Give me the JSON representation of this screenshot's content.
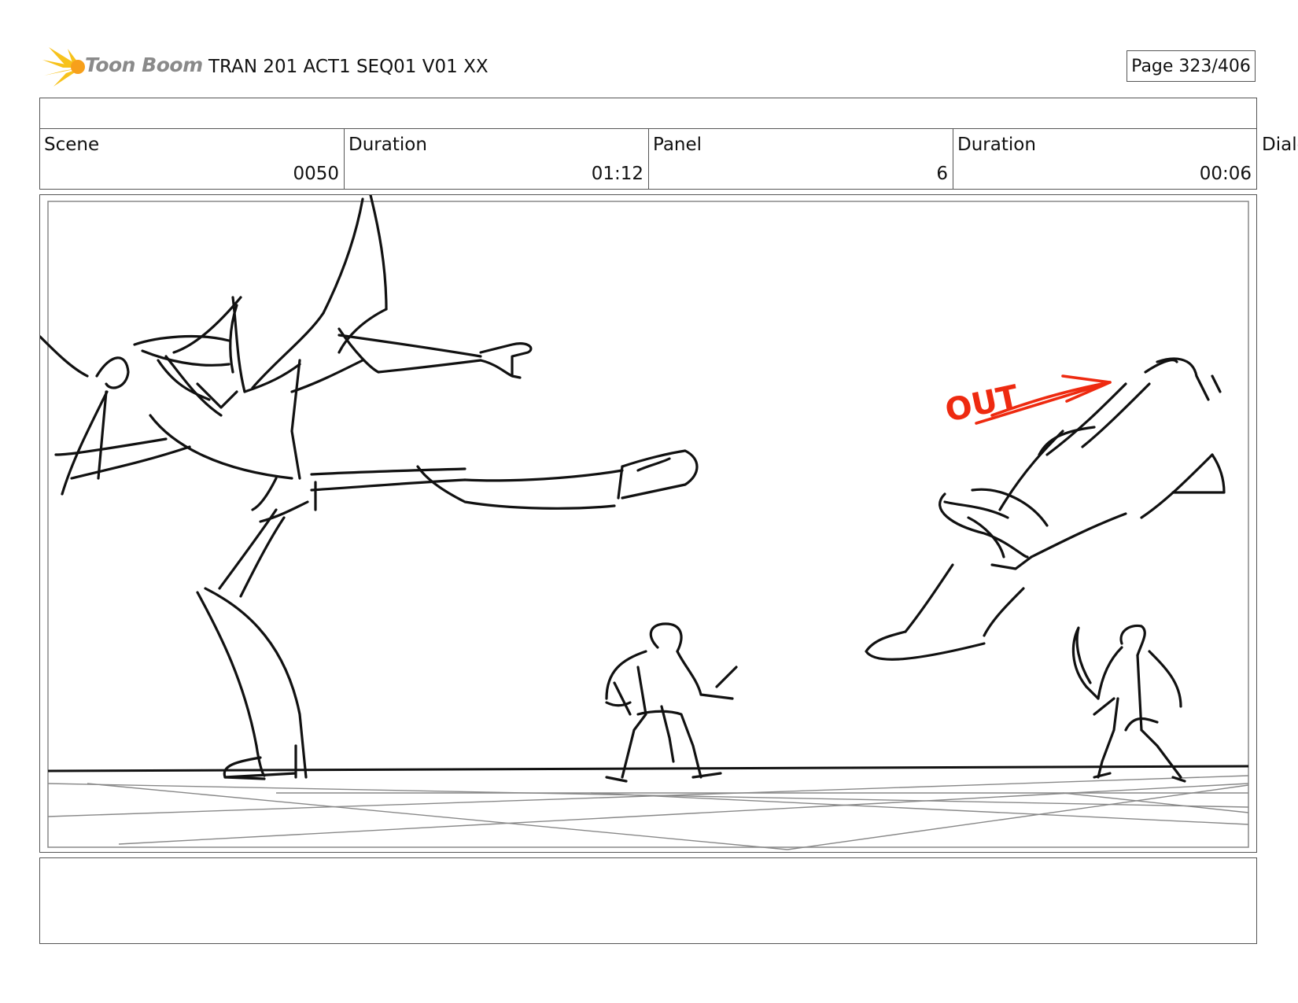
{
  "header": {
    "logo_text": "Toon Boom",
    "document_title": "TRAN 201 ACT1 SEQ01 V01 XX",
    "page_indicator": "Page 323/406"
  },
  "info": {
    "scene_label": "Scene",
    "scene_value": "0050",
    "scene_duration_label": "Duration",
    "scene_duration_value": "01:12",
    "panel_label": "Panel",
    "panel_value": "6",
    "panel_duration_label": "Duration",
    "panel_duration_value": "00:06",
    "dialog_label": "Dialog"
  },
  "panel": {
    "annotation_text": "OUT",
    "annotation_color": "#ee2a10",
    "line_color": "#111111",
    "grid_color": "#888888"
  },
  "colors": {
    "logo_star": "#f7c21b",
    "logo_text": "#8a8a8a",
    "border": "#555555"
  }
}
